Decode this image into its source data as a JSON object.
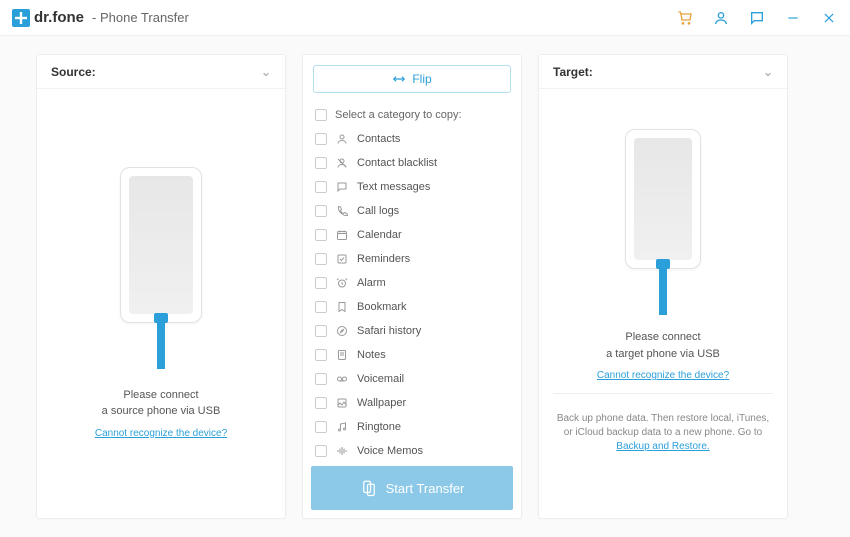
{
  "titlebar": {
    "brand": "dr.fone",
    "subtitle": "- Phone Transfer"
  },
  "source": {
    "label": "Source:",
    "message_line1": "Please connect",
    "message_line2": "a source phone via USB",
    "help_link": "Cannot recognize the device?"
  },
  "target": {
    "label": "Target:",
    "message_line1": "Please connect",
    "message_line2": "a target phone via USB",
    "help_link": "Cannot recognize the device?",
    "footer_text": "Back up phone data. Then restore local, iTunes, or iCloud backup data to a new phone. Go to ",
    "footer_link": "Backup and Restore."
  },
  "mid": {
    "flip_label": "Flip",
    "select_header": "Select a category to copy:",
    "start_label": "Start Transfer",
    "categories": [
      {
        "label": "Contacts",
        "icon": "contact"
      },
      {
        "label": "Contact blacklist",
        "icon": "blacklist"
      },
      {
        "label": "Text messages",
        "icon": "message"
      },
      {
        "label": "Call logs",
        "icon": "call"
      },
      {
        "label": "Calendar",
        "icon": "calendar"
      },
      {
        "label": "Reminders",
        "icon": "reminder"
      },
      {
        "label": "Alarm",
        "icon": "alarm"
      },
      {
        "label": "Bookmark",
        "icon": "bookmark"
      },
      {
        "label": "Safari history",
        "icon": "safari"
      },
      {
        "label": "Notes",
        "icon": "notes"
      },
      {
        "label": "Voicemail",
        "icon": "voicemail"
      },
      {
        "label": "Wallpaper",
        "icon": "wallpaper"
      },
      {
        "label": "Ringtone",
        "icon": "ringtone"
      },
      {
        "label": "Voice Memos",
        "icon": "voicememo"
      }
    ]
  },
  "colors": {
    "accent": "#2b9fd9"
  }
}
